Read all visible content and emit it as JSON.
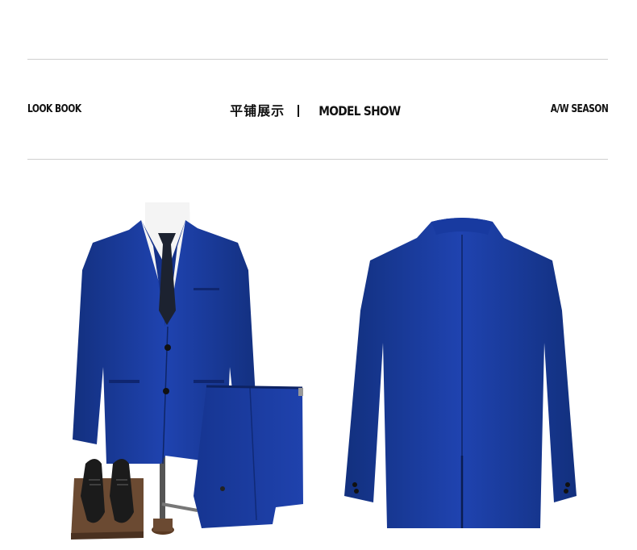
{
  "header": {
    "left_label": "LOOK BOOK",
    "center_cn": "平铺展示",
    "center_en": "MODEL SHOW",
    "right_label": "A/W SEASON"
  },
  "colors": {
    "suit": "#1a3aa0",
    "suit_dark": "#0f2575",
    "rule": "#cfcfcf",
    "text": "#111111",
    "shoe": "#1b1b1b",
    "wood": "#6b4a32"
  },
  "images": {
    "front_view": "suit-front-with-trousers-and-shoes",
    "back_view": "suit-jacket-back"
  }
}
